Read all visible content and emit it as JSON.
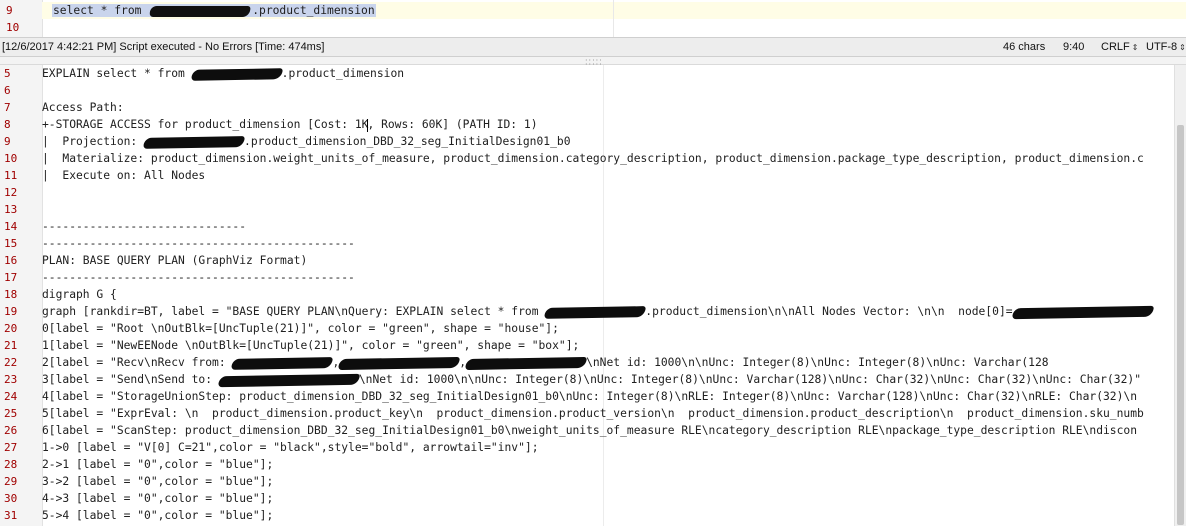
{
  "top_editor": {
    "line_numbers": [
      "9",
      "10"
    ],
    "query_prefix": "select * from ",
    "query_suffix": ".product_dimension"
  },
  "status_bar": {
    "message": "[12/6/2017 4:42:21 PM] Script executed - No Errors [Time: 474ms]",
    "char_count": "46 chars",
    "position": "9:40",
    "line_ending": "CRLF",
    "encoding": "UTF-8"
  },
  "output_lines": [
    {
      "n": "5",
      "parts": [
        "EXPLAIN select * from ",
        "#R90",
        ".product_dimension"
      ]
    },
    {
      "n": "6",
      "parts": [
        ""
      ]
    },
    {
      "n": "7",
      "parts": [
        "Access Path:"
      ]
    },
    {
      "n": "8",
      "parts": [
        "+-STORAGE ACCESS for product_dimension [Cost: 1K",
        "#C",
        ", Rows: 60K] (PATH ID: 1)"
      ]
    },
    {
      "n": "9",
      "parts": [
        "|  Projection: ",
        "#R100",
        ".product_dimension_DBD_32_seg_InitialDesign01_b0"
      ]
    },
    {
      "n": "10",
      "parts": [
        "|  Materialize: product_dimension.weight_units_of_measure, product_dimension.category_description, product_dimension.package_type_description, product_dimension.c"
      ]
    },
    {
      "n": "11",
      "parts": [
        "|  Execute on: All Nodes"
      ]
    },
    {
      "n": "12",
      "parts": [
        ""
      ]
    },
    {
      "n": "13",
      "parts": [
        ""
      ]
    },
    {
      "n": "14",
      "parts": [
        "------------------------------"
      ]
    },
    {
      "n": "15",
      "parts": [
        "----------------------------------------------"
      ]
    },
    {
      "n": "16",
      "parts": [
        "PLAN: BASE QUERY PLAN (GraphViz Format)"
      ]
    },
    {
      "n": "17",
      "parts": [
        "----------------------------------------------"
      ]
    },
    {
      "n": "18",
      "parts": [
        "digraph G {"
      ]
    },
    {
      "n": "19",
      "parts": [
        "graph [rankdir=BT, label = \"BASE QUERY PLAN\\nQuery: EXPLAIN select * from ",
        "#R100",
        ".product_dimension\\n\\nAll Nodes Vector: \\n\\n  node[0]=",
        "#R140"
      ]
    },
    {
      "n": "20",
      "parts": [
        "0[label = \"Root \\nOutBlk=[UncTuple(21)]\", color = \"green\", shape = \"house\"];"
      ]
    },
    {
      "n": "21",
      "parts": [
        "1[label = \"NewEENode \\nOutBlk=[UncTuple(21)]\", color = \"green\", shape = \"box\"];"
      ]
    },
    {
      "n": "22",
      "parts": [
        "2[label = \"Recv\\nRecv from: ",
        "#R100",
        ",",
        "#R120",
        ",",
        "#R120",
        "\\nNet id: 1000\\n\\nUnc: Integer(8)\\nUnc: Integer(8)\\nUnc: Varchar(128"
      ]
    },
    {
      "n": "23",
      "parts": [
        "3[label = \"Send\\nSend to: ",
        "#R140",
        "\\nNet id: 1000\\n\\nUnc: Integer(8)\\nUnc: Integer(8)\\nUnc: Varchar(128)\\nUnc: Char(32)\\nUnc: Char(32)\\nUnc: Char(32)\""
      ]
    },
    {
      "n": "24",
      "parts": [
        "4[label = \"StorageUnionStep: product_dimension_DBD_32_seg_InitialDesign01_b0\\nUnc: Integer(8)\\nRLE: Integer(8)\\nUnc: Varchar(128)\\nUnc: Char(32)\\nRLE: Char(32)\\n"
      ]
    },
    {
      "n": "25",
      "parts": [
        "5[label = \"ExprEval: \\n  product_dimension.product_key\\n  product_dimension.product_version\\n  product_dimension.product_description\\n  product_dimension.sku_numb"
      ]
    },
    {
      "n": "26",
      "parts": [
        "6[label = \"ScanStep: product_dimension_DBD_32_seg_InitialDesign01_b0\\nweight_units_of_measure RLE\\ncategory_description RLE\\npackage_type_description RLE\\ndiscon"
      ]
    },
    {
      "n": "27",
      "parts": [
        "1->0 [label = \"V[0] C=21\",color = \"black\",style=\"bold\", arrowtail=\"inv\"];"
      ]
    },
    {
      "n": "28",
      "parts": [
        "2->1 [label = \"0\",color = \"blue\"];"
      ]
    },
    {
      "n": "29",
      "parts": [
        "3->2 [label = \"0\",color = \"blue\"];"
      ]
    },
    {
      "n": "30",
      "parts": [
        "4->3 [label = \"0\",color = \"blue\"];"
      ]
    },
    {
      "n": "31",
      "parts": [
        "5->4 [label = \"0\",color = \"blue\"];"
      ]
    }
  ]
}
